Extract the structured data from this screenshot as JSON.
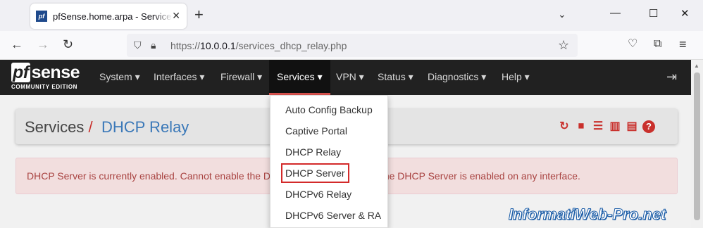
{
  "browser": {
    "tab_title": "pfSense.home.arpa - Services: DHCP Relay",
    "favicon_text": "pf",
    "url_prefix": "https://",
    "url_host": "10.0.0.1",
    "url_path": "/services_dhcp_relay.php"
  },
  "pfsense": {
    "logo_main": "sense",
    "logo_pf": "pf",
    "logo_sub": "COMMUNITY EDITION",
    "menu": [
      {
        "label": "System ▾"
      },
      {
        "label": "Interfaces ▾"
      },
      {
        "label": "Firewall ▾"
      },
      {
        "label": "Services ▾"
      },
      {
        "label": "VPN ▾"
      },
      {
        "label": "Status ▾"
      },
      {
        "label": "Diagnostics ▾"
      },
      {
        "label": "Help ▾"
      }
    ],
    "active_menu": "Services"
  },
  "breadcrumb": {
    "parent": "Services",
    "separator": "/",
    "current": "DHCP Relay"
  },
  "alert": {
    "text": "DHCP Server is currently enabled. Cannot enable the DHCP Relay service while the DHCP Server is enabled on any interface."
  },
  "dropdown": {
    "items": [
      {
        "label": "Auto Config Backup"
      },
      {
        "label": "Captive Portal"
      },
      {
        "label": "DHCP Relay"
      },
      {
        "label": "DHCP Server"
      },
      {
        "label": "DHCPv6 Relay"
      },
      {
        "label": "DHCPv6 Server & RA"
      }
    ],
    "highlighted": "DHCP Server"
  },
  "watermark": "InformatiWeb-Pro.net",
  "colors": {
    "header_bg": "#212121",
    "accent_red": "#d9534f",
    "link_blue": "#3a78b8",
    "alert_bg": "#f2dede",
    "alert_text": "#a94442"
  },
  "icons": {
    "breadcrumb": [
      "reload-icon",
      "stop-icon",
      "sliders-icon",
      "bar-chart-icon",
      "log-icon",
      "help-icon"
    ]
  }
}
